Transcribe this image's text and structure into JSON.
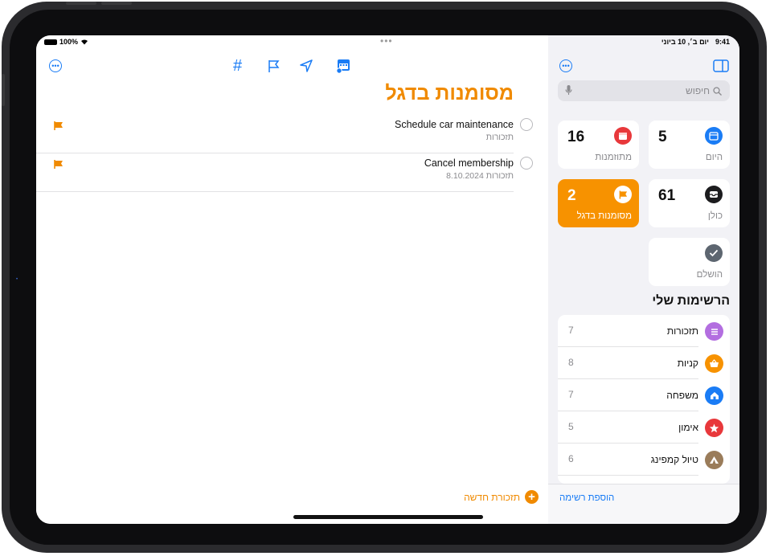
{
  "status": {
    "battery": "100%",
    "time": "9:41",
    "date": "יום ב׳, 10 ביוני"
  },
  "toolbar": {
    "more_icon": "ellipsis-circle-icon",
    "tag_symbol": "#",
    "icons": [
      "tag-icon",
      "flag-icon",
      "location-icon",
      "calendar-icon"
    ],
    "multitask_dots": "•••"
  },
  "main": {
    "title": "מסומנות בדגל",
    "reminders": [
      {
        "title": "Schedule car maintenance",
        "subtitle": "תזכורות"
      },
      {
        "title": "Cancel membership",
        "subtitle": "תזכורות  8.10.2024"
      }
    ],
    "new_reminder": "תזכורת חדשה",
    "plus": "+"
  },
  "sidebar": {
    "search_placeholder": "חיפוש",
    "cards": [
      {
        "id": "today",
        "label": "היום",
        "count": "5",
        "color": "#1a7cf5"
      },
      {
        "id": "scheduled",
        "label": "מתוזמנות",
        "count": "16",
        "color": "#e8383b"
      },
      {
        "id": "all",
        "label": "כולן",
        "count": "61",
        "color": "#1c1c1e"
      },
      {
        "id": "flagged",
        "label": "מסומנות בדגל",
        "count": "2",
        "color": "#f79200"
      },
      {
        "id": "completed",
        "label": "הושלם",
        "count": "",
        "color": "#5d6670"
      }
    ],
    "my_lists_header": "הרשימות שלי",
    "lists": [
      {
        "name": "תזכורות",
        "count": "7",
        "color": "#b36ee0",
        "icon": "list-icon"
      },
      {
        "name": "קניות",
        "count": "8",
        "color": "#f79200",
        "icon": "basket-icon"
      },
      {
        "name": "משפחה",
        "count": "7",
        "color": "#1a7cf5",
        "icon": "house-icon"
      },
      {
        "name": "אימון",
        "count": "5",
        "color": "#e8383b",
        "icon": "star-icon"
      },
      {
        "name": "טיול קמפינג",
        "count": "6",
        "color": "#9a7c5a",
        "icon": "tent-icon"
      }
    ],
    "add_list": "הוספת רשימה"
  },
  "colors": {
    "accent": "#1a7cf5",
    "flag": "#f08a00"
  }
}
